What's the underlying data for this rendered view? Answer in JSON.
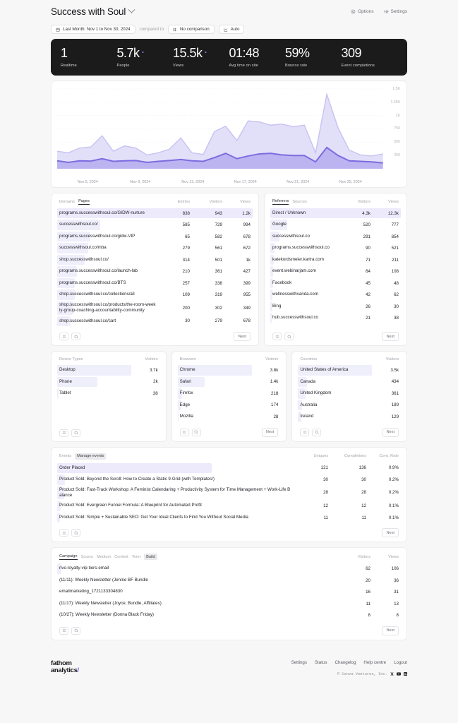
{
  "header": {
    "site_title": "Success with Soul",
    "options_label": "Options",
    "settings_label": "Settings"
  },
  "toolbar": {
    "date_range": "Last Month: Nov 1 to Nov 30, 2024",
    "compared_to": "compared to",
    "comparison": "No comparison",
    "interval": "Auto"
  },
  "stats": [
    {
      "value": "1",
      "label": "Realtime",
      "dot": false
    },
    {
      "value": "5.7k",
      "label": "People",
      "dot": true
    },
    {
      "value": "15.5k",
      "label": "Views",
      "dot": true
    },
    {
      "value": "01:48",
      "label": "Avg time on site",
      "dot": false
    },
    {
      "value": "59%",
      "label": "Bounce rate",
      "dot": false
    },
    {
      "value": "309",
      "label": "Event completions",
      "dot": false
    }
  ],
  "chart_data": {
    "type": "area",
    "title": "",
    "xlabel": "",
    "ylabel": "",
    "ylim": [
      0,
      1500
    ],
    "grid": true,
    "legend_position": "none",
    "ytick_labels": [
      "1.5K",
      "1.25K",
      "1K",
      "750",
      "500",
      "250"
    ],
    "yticks": [
      1500,
      1250,
      1000,
      750,
      500,
      250
    ],
    "xtick_labels": [
      "Nov 5, 2024",
      "Nov 9, 2024",
      "Nov 13, 2024",
      "Nov 17, 2024",
      "Nov 21, 2024",
      "Nov 25, 2024"
    ],
    "x": [
      "Nov 1",
      "Nov 2",
      "Nov 3",
      "Nov 4",
      "Nov 5",
      "Nov 6",
      "Nov 7",
      "Nov 8",
      "Nov 9",
      "Nov 10",
      "Nov 11",
      "Nov 12",
      "Nov 13",
      "Nov 14",
      "Nov 15",
      "Nov 16",
      "Nov 17",
      "Nov 18",
      "Nov 19",
      "Nov 20",
      "Nov 21",
      "Nov 22",
      "Nov 23",
      "Nov 24",
      "Nov 25",
      "Nov 26",
      "Nov 27",
      "Nov 28",
      "Nov 29",
      "Nov 30"
    ],
    "series": [
      {
        "name": "Views",
        "color": "#ddd9f7",
        "values": [
          330,
          300,
          390,
          410,
          620,
          330,
          430,
          390,
          260,
          300,
          370,
          580,
          300,
          270,
          700,
          800,
          530,
          900,
          880,
          820,
          840,
          790,
          820,
          300,
          1400,
          770,
          350,
          260,
          240,
          280
        ]
      },
      {
        "name": "People",
        "color": "#b9b0f0",
        "values": [
          150,
          120,
          150,
          145,
          190,
          140,
          150,
          155,
          120,
          140,
          155,
          175,
          150,
          140,
          210,
          290,
          190,
          240,
          280,
          290,
          260,
          250,
          250,
          130,
          400,
          250,
          150,
          140,
          130,
          110
        ]
      }
    ]
  },
  "pages_table": {
    "tabs": [
      {
        "label": "Domains",
        "active": false
      },
      {
        "label": "Pages",
        "active": true
      }
    ],
    "columns": [
      "Entries",
      "Visitors",
      "Views"
    ],
    "rows": [
      {
        "label": "programs.successwithsoul.co/GIDW-nurture",
        "entries": "838",
        "visitors": "943",
        "views": "1.2k",
        "bar": 100,
        "highlight": true
      },
      {
        "label": "successwithsoul.co/",
        "entries": "585",
        "visitors": "729",
        "views": "994",
        "bar": 22,
        "highlight": false
      },
      {
        "label": "programs.successwithsoul.co/gidw-VIP",
        "entries": "65",
        "visitors": "582",
        "views": "678",
        "bar": 17,
        "highlight": false
      },
      {
        "label": "successwithsoul.co/mba",
        "entries": "279",
        "visitors": "561",
        "views": "672",
        "bar": 16,
        "highlight": false
      },
      {
        "label": "shop.successwithsoul.co/",
        "entries": "314",
        "visitors": "501",
        "views": "1k",
        "bar": 14,
        "highlight": false
      },
      {
        "label": "programs.successwithsoul.co/launch-lab",
        "entries": "210",
        "visitors": "361",
        "views": "427",
        "bar": 10,
        "highlight": false
      },
      {
        "label": "programs.successwithsoul.co/BTS",
        "entries": "257",
        "visitors": "338",
        "views": "399",
        "bar": 9,
        "highlight": false
      },
      {
        "label": "shop.successwithsoul.co/collections/all",
        "entries": "109",
        "visitors": "319",
        "views": "955",
        "bar": 9,
        "highlight": false
      },
      {
        "label": "shop.successwithsoul.co/products/the-room-weekly-group-coaching-accountability-community",
        "entries": "200",
        "visitors": "302",
        "views": "349",
        "bar": 8,
        "highlight": false
      },
      {
        "label": "shop.successwithsoul.co/cart",
        "entries": "30",
        "visitors": "279",
        "views": "678",
        "bar": 7,
        "highlight": false
      }
    ],
    "next_label": "Next"
  },
  "referrers_table": {
    "tabs": [
      {
        "label": "Referrers",
        "active": true
      },
      {
        "label": "Sources",
        "active": false
      }
    ],
    "columns": [
      "Visitors",
      "Views"
    ],
    "rows": [
      {
        "label": "Direct / Unknown",
        "visitors": "4.3k",
        "views": "12.3k",
        "bar": 100,
        "highlight": true
      },
      {
        "label": "Google",
        "visitors": "520",
        "views": "777",
        "bar": 13,
        "highlight": false
      },
      {
        "label": "successwithsoul.co",
        "visitors": "291",
        "views": "854",
        "bar": 7,
        "highlight": false
      },
      {
        "label": "programs.successwithsoul.co",
        "visitors": "90",
        "views": "521",
        "bar": 3,
        "highlight": false
      },
      {
        "label": "katekordsmeier.kartra.com",
        "visitors": "71",
        "views": "211",
        "bar": 2.5,
        "highlight": false
      },
      {
        "label": "event.webinarjam.com",
        "visitors": "64",
        "views": "108",
        "bar": 2.2,
        "highlight": false
      },
      {
        "label": "Facebook",
        "visitors": "45",
        "views": "48",
        "bar": 2,
        "highlight": false
      },
      {
        "label": "wellnesswithvanda.com",
        "visitors": "42",
        "views": "62",
        "bar": 1.8,
        "highlight": false
      },
      {
        "label": "Bing",
        "visitors": "26",
        "views": "30",
        "bar": 1.5,
        "highlight": false
      },
      {
        "label": "hub.successwithsoul.co",
        "visitors": "21",
        "views": "38",
        "bar": 1.3,
        "highlight": false
      }
    ],
    "next_label": "Next"
  },
  "device_table": {
    "tabs": [
      {
        "label": "Device Types",
        "active": false
      }
    ],
    "columns": [
      "Visitors"
    ],
    "rows": [
      {
        "label": "Desktop",
        "visitors": "3.7k",
        "bar": 100,
        "highlight": false
      },
      {
        "label": "Phone",
        "visitors": "2k",
        "bar": 54,
        "highlight": false
      },
      {
        "label": "Tablet",
        "visitors": "38",
        "bar": 1.5,
        "highlight": false
      }
    ],
    "next_label": ""
  },
  "browsers_table": {
    "tabs": [
      {
        "label": "Browsers",
        "active": false
      }
    ],
    "columns": [
      "Visitors"
    ],
    "rows": [
      {
        "label": "Chrome",
        "visitors": "3.8k",
        "bar": 100,
        "highlight": false
      },
      {
        "label": "Safari",
        "visitors": "1.4k",
        "bar": 37,
        "highlight": false
      },
      {
        "label": "Firefox",
        "visitors": "218",
        "bar": 6,
        "highlight": false
      },
      {
        "label": "Edge",
        "visitors": "174",
        "bar": 5,
        "highlight": false
      },
      {
        "label": "Mozilla",
        "visitors": "28",
        "bar": 1.5,
        "highlight": false
      }
    ],
    "next_label": "Next"
  },
  "countries_table": {
    "tabs": [
      {
        "label": "Countries",
        "active": false
      }
    ],
    "columns": [
      "Visitors"
    ],
    "rows": [
      {
        "label": "United States of America",
        "visitors": "3.5k",
        "bar": 100,
        "highlight": false
      },
      {
        "label": "Canada",
        "visitors": "434",
        "bar": 12,
        "highlight": false
      },
      {
        "label": "United Kingdom",
        "visitors": "361",
        "bar": 10,
        "highlight": false
      },
      {
        "label": "Australia",
        "visitors": "189",
        "bar": 5.5,
        "highlight": false
      },
      {
        "label": "Ireland",
        "visitors": "129",
        "bar": 4,
        "highlight": false
      }
    ],
    "next_label": "Next"
  },
  "events_table": {
    "tabs": [
      {
        "label": "Events",
        "active": false
      },
      {
        "label": "Manage events",
        "active": false,
        "badge": true
      }
    ],
    "columns": [
      "Uniques",
      "Completions",
      "Conv. Rate"
    ],
    "rows": [
      {
        "label": "Order Placed",
        "uniques": "121",
        "completions": "136",
        "conv": "0.9%",
        "bar": 100,
        "highlight": true
      },
      {
        "label": "Product Sold: Beyond the Scroll: How to Create a Static 9-Grid (with Templates!)",
        "uniques": "30",
        "completions": "30",
        "conv": "0.2%",
        "bar": 5,
        "highlight": false
      },
      {
        "label": "Product Sold: Fast-Track Workshop: A Feminist Calendaring + Productivity System for Time Management + Work-Life Balance",
        "uniques": "28",
        "completions": "28",
        "conv": "0.2%",
        "bar": 4.6,
        "highlight": false
      },
      {
        "label": "Product Sold: Evergreen Funnel Formula: A Blueprint for Automated Profit",
        "uniques": "12",
        "completions": "12",
        "conv": "0.1%",
        "bar": 2.2,
        "highlight": false
      },
      {
        "label": "Product Sold: Simple + Sustainable SEO: Get Your Ideal Clients to Find You Without Social Media",
        "uniques": "11",
        "completions": "11",
        "conv": "0.1%",
        "bar": 2,
        "highlight": false
      }
    ],
    "next_label": "Next"
  },
  "campaign_table": {
    "tabs": [
      {
        "label": "Campaign",
        "active": true
      },
      {
        "label": "Source",
        "active": false
      },
      {
        "label": "Medium",
        "active": false
      },
      {
        "label": "Content",
        "active": false
      },
      {
        "label": "Term",
        "active": false
      },
      {
        "label": "Build",
        "active": false,
        "badge": true
      }
    ],
    "columns": [
      "Visitors",
      "Views"
    ],
    "rows": [
      {
        "label": "rivo-loyalty-vip-tiers-email",
        "visitors": "62",
        "views": "106",
        "bar": 1.2,
        "highlight": false
      },
      {
        "label": "(11/11): Weekly Newsletter (Jennie   BF Bundle",
        "visitors": "20",
        "views": "36",
        "bar": 0,
        "highlight": false
      },
      {
        "label": "emailmarketing_1721133304830",
        "visitors": "16",
        "views": "31",
        "bar": 0,
        "highlight": false
      },
      {
        "label": "(11/17): Weekly Newsletter (Joyce, Bundle, Affiliates)",
        "visitors": "11",
        "views": "13",
        "bar": 0,
        "highlight": false
      },
      {
        "label": "(10/27): Weekly Newsletter (Donna   Black Friday)",
        "visitors": "8",
        "views": "8",
        "bar": 0,
        "highlight": false
      }
    ],
    "next_label": "Next"
  },
  "footer": {
    "logo_line1": "fathom",
    "logo_line2": "analytics",
    "logo_slash": "/",
    "links": [
      "Settings",
      "Status",
      "Changelog",
      "Help centre",
      "Logout"
    ],
    "copyright": "© Conva Ventures, Inc."
  }
}
